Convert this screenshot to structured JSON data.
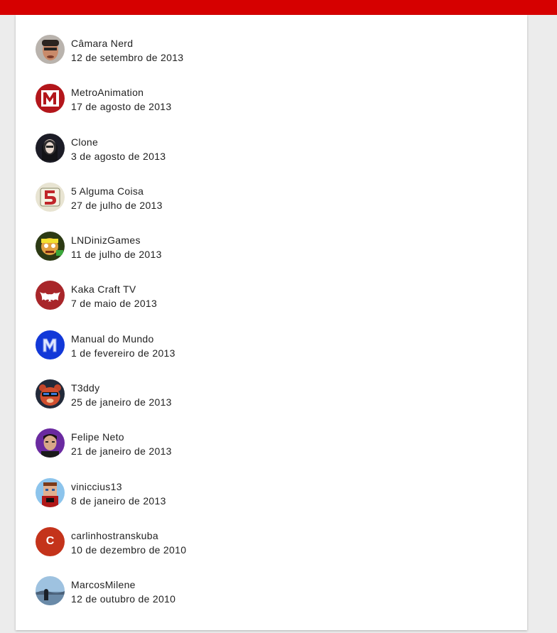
{
  "subscriptions": [
    {
      "name": "Câmara Nerd",
      "date": "12 de setembro de 2013",
      "avatar": "face-avatar-icon"
    },
    {
      "name": "MetroAnimation",
      "date": "17 de agosto de 2013",
      "avatar": "red-m-logo-icon"
    },
    {
      "name": "Clone",
      "date": "3 de agosto de 2013",
      "avatar": "dark-portrait-icon"
    },
    {
      "name": "5 Alguma Coisa",
      "date": "27 de julho de 2013",
      "avatar": "number-5-logo-icon"
    },
    {
      "name": "LNDinizGames",
      "date": "11 de julho de 2013",
      "avatar": "cartoon-character-icon"
    },
    {
      "name": "Kaka Craft TV",
      "date": "7 de maio de 2013",
      "avatar": "bat-logo-icon"
    },
    {
      "name": "Manual do Mundo",
      "date": "1 de fevereiro de 2013",
      "avatar": "blue-m-logo-icon"
    },
    {
      "name": "T3ddy",
      "date": "25 de janeiro de 2013",
      "avatar": "bear-sunglasses-icon"
    },
    {
      "name": "Felipe Neto",
      "date": "21 de janeiro de 2013",
      "avatar": "purple-portrait-icon"
    },
    {
      "name": "viniccius13",
      "date": "8 de janeiro de 2013",
      "avatar": "minecraft-character-icon"
    },
    {
      "name": "carlinhostranskuba",
      "date": "10 de dezembro de 2010",
      "avatar": "letter-c-avatar-icon",
      "letter": "C"
    },
    {
      "name": "MarcosMilene",
      "date": "12 de outubro de 2010",
      "avatar": "landscape-photo-icon"
    }
  ],
  "colors": {
    "header": "#d60000",
    "letter_avatar": "#c4331b"
  }
}
